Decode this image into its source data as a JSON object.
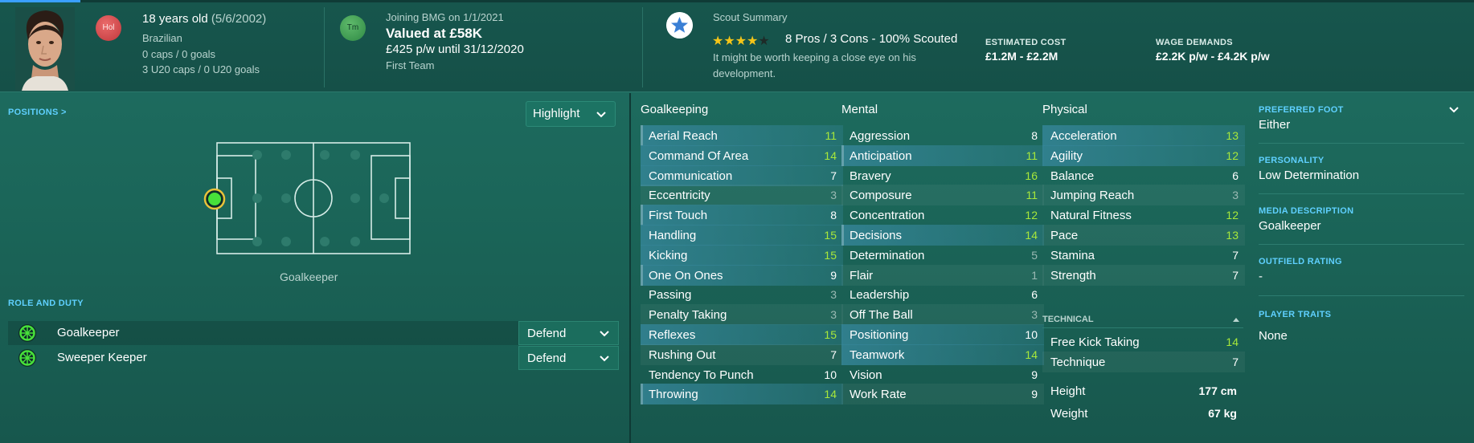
{
  "header": {
    "age": "18 years old",
    "dob": "(5/6/2002)",
    "nationality": "Brazilian",
    "caps": "0 caps / 0 goals",
    "u20_caps": "3 U20 caps / 0 U20 goals",
    "nation_badge": "Hol",
    "club_badge": "Tm",
    "joining": "Joining BMG on 1/1/2021",
    "value": "Valued at £58K",
    "contract": "£425 p/w until 31/12/2020",
    "squad": "First Team",
    "scout_title": "Scout Summary",
    "stars_filled": 4,
    "stars_total": 5,
    "scout_line": "8 Pros / 3 Cons - 100% Scouted",
    "scout_note_1": "It might be worth keeping a close eye on his",
    "scout_note_2": "development.",
    "cost_label": "ESTIMATED COST",
    "cost_value": "£1.2M - £2.2M",
    "wage_label": "WAGE DEMANDS",
    "wage_value": "£2.2K p/w - £4.2K p/w"
  },
  "left": {
    "positions_link": "POSITIONS >",
    "highlight_label": "Highlight",
    "position_name": "Goalkeeper",
    "role_title": "ROLE AND DUTY",
    "roles": [
      {
        "name": "Goalkeeper",
        "duty": "Defend"
      },
      {
        "name": "Sweeper Keeper",
        "duty": "Defend"
      }
    ]
  },
  "attributes": {
    "goalkeeping_title": "Goalkeeping",
    "mental_title": "Mental",
    "physical_title": "Physical",
    "technical_title": "TECHNICAL",
    "goalkeeping": [
      {
        "name": "Aerial Reach",
        "value": "11"
      },
      {
        "name": "Command Of Area",
        "value": "14"
      },
      {
        "name": "Communication",
        "value": "7"
      },
      {
        "name": "Eccentricity",
        "value": "3"
      },
      {
        "name": "First Touch",
        "value": "8"
      },
      {
        "name": "Handling",
        "value": "15"
      },
      {
        "name": "Kicking",
        "value": "15"
      },
      {
        "name": "One On Ones",
        "value": "9"
      },
      {
        "name": "Passing",
        "value": "3"
      },
      {
        "name": "Penalty Taking",
        "value": "3"
      },
      {
        "name": "Reflexes",
        "value": "15"
      },
      {
        "name": "Rushing Out",
        "value": "7"
      },
      {
        "name": "Tendency To Punch",
        "value": "10"
      },
      {
        "name": "Throwing",
        "value": "14"
      }
    ],
    "mental": [
      {
        "name": "Aggression",
        "value": "8"
      },
      {
        "name": "Anticipation",
        "value": "11"
      },
      {
        "name": "Bravery",
        "value": "16"
      },
      {
        "name": "Composure",
        "value": "11"
      },
      {
        "name": "Concentration",
        "value": "12"
      },
      {
        "name": "Decisions",
        "value": "14"
      },
      {
        "name": "Determination",
        "value": "5"
      },
      {
        "name": "Flair",
        "value": "1"
      },
      {
        "name": "Leadership",
        "value": "6"
      },
      {
        "name": "Off The Ball",
        "value": "3"
      },
      {
        "name": "Positioning",
        "value": "10"
      },
      {
        "name": "Teamwork",
        "value": "14"
      },
      {
        "name": "Vision",
        "value": "9"
      },
      {
        "name": "Work Rate",
        "value": "9"
      }
    ],
    "physical": [
      {
        "name": "Acceleration",
        "value": "13"
      },
      {
        "name": "Agility",
        "value": "12"
      },
      {
        "name": "Balance",
        "value": "6"
      },
      {
        "name": "Jumping Reach",
        "value": "3"
      },
      {
        "name": "Natural Fitness",
        "value": "12"
      },
      {
        "name": "Pace",
        "value": "13"
      },
      {
        "name": "Stamina",
        "value": "7"
      },
      {
        "name": "Strength",
        "value": "7"
      }
    ],
    "technical": [
      {
        "name": "Free Kick Taking",
        "value": "14"
      },
      {
        "name": "Technique",
        "value": "7"
      }
    ],
    "height_label": "Height",
    "height_value": "177 cm",
    "weight_label": "Weight",
    "weight_value": "67 kg"
  },
  "right": {
    "foot_label": "PREFERRED FOOT",
    "foot_value": "Either",
    "personality_label": "PERSONALITY",
    "personality_value": "Low Determination",
    "media_label": "MEDIA DESCRIPTION",
    "media_value": "Goalkeeper",
    "outfield_label": "OUTFIELD RATING",
    "outfield_value": "-",
    "traits_label": "PLAYER TRAITS",
    "traits_value": "None"
  },
  "colors": {
    "background": "#1b6659",
    "highlight_row": "#348496",
    "good_value": "#a8e83a",
    "link": "#5fd0ff",
    "star": "#f5c518"
  }
}
